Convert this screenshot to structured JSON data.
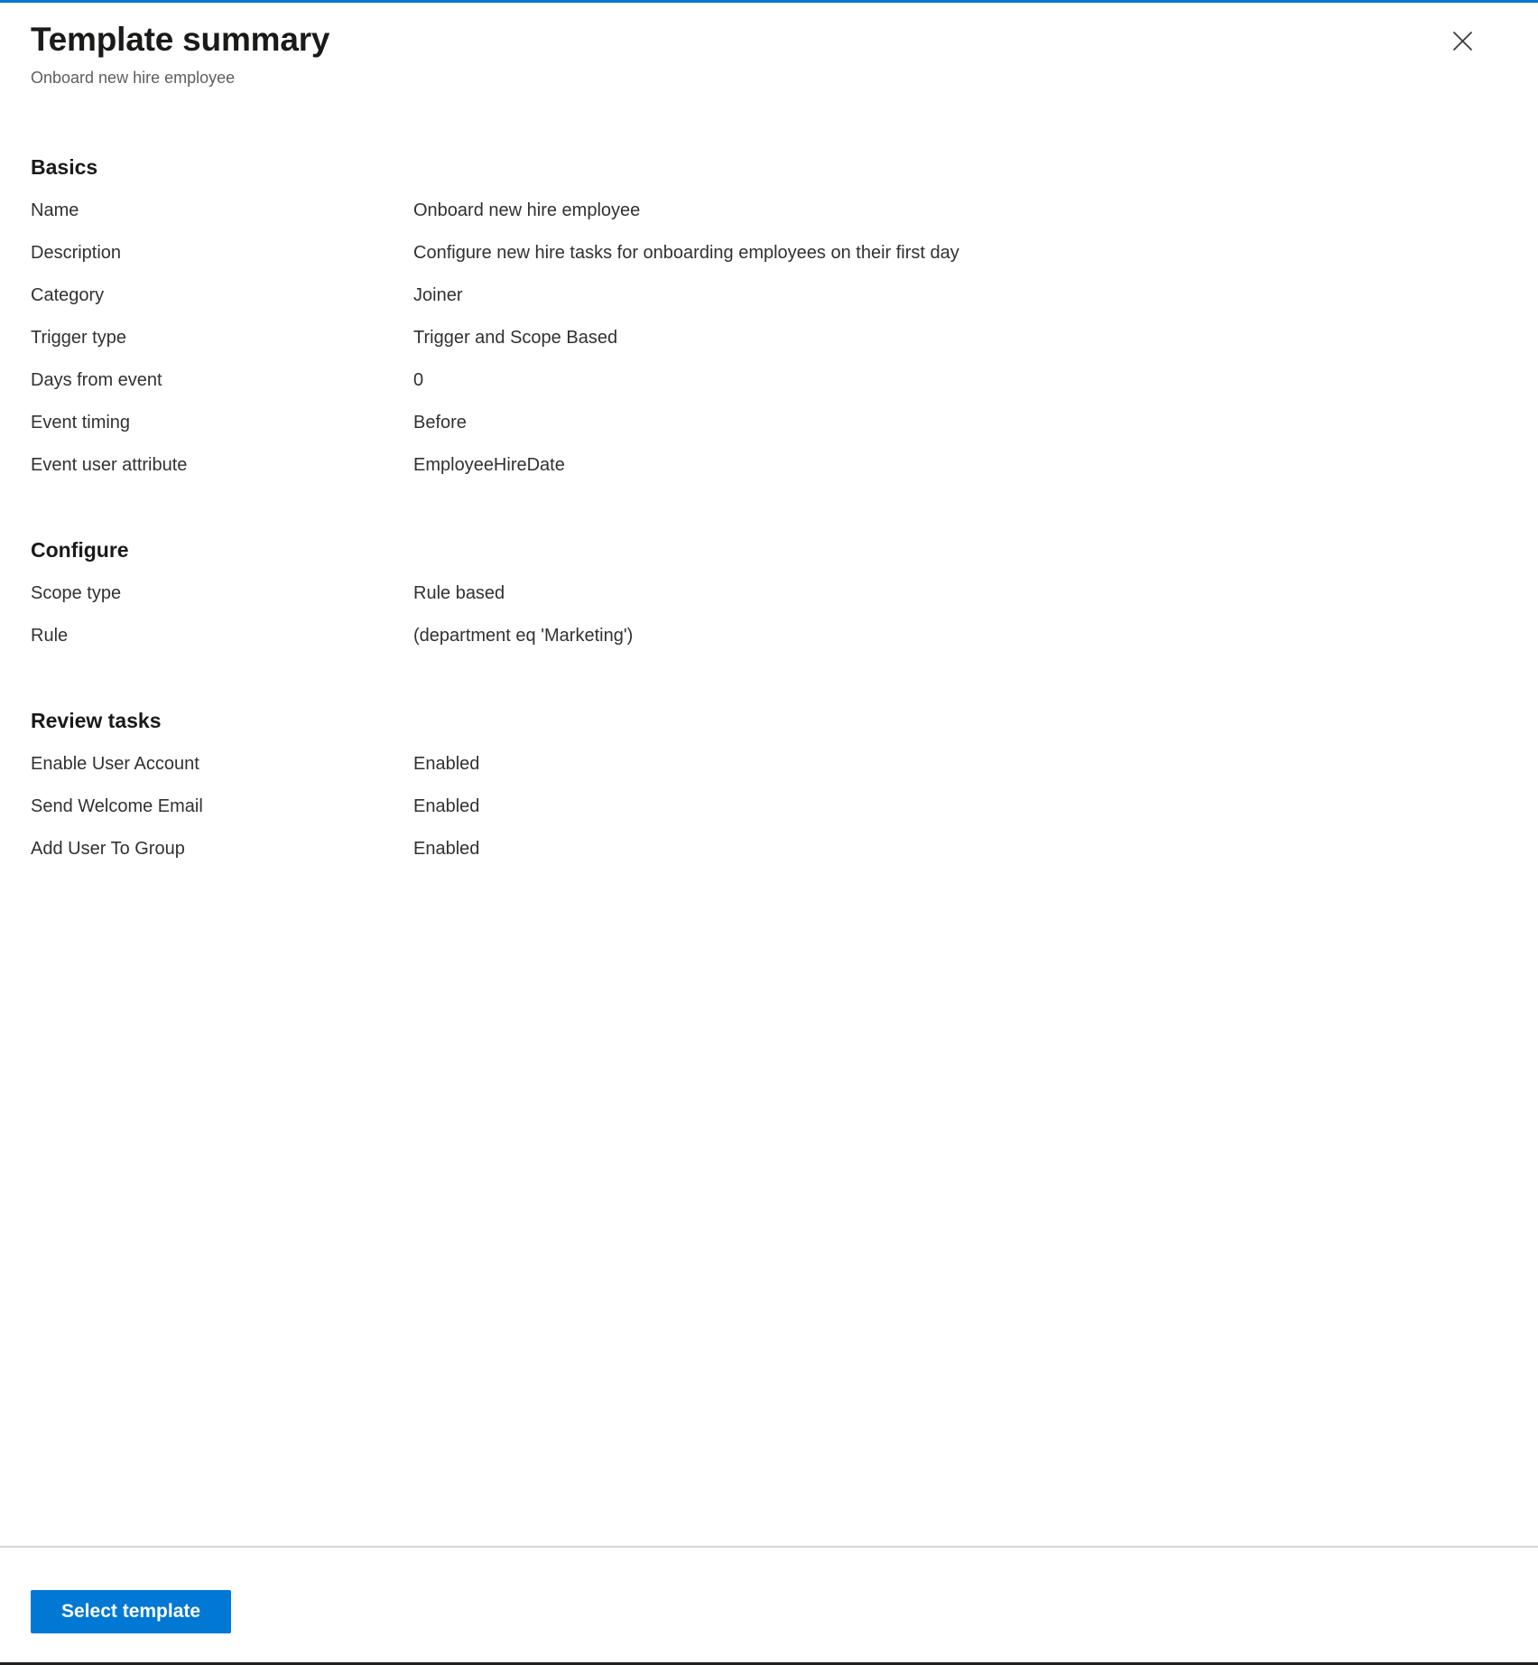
{
  "header": {
    "title": "Template summary",
    "subtitle": "Onboard new hire employee",
    "close_icon": "close-icon",
    "close_label": "Close"
  },
  "accent_color": "#0078d4",
  "sections": [
    {
      "heading": "Basics",
      "rows": [
        {
          "label": "Name",
          "value": "Onboard new hire employee"
        },
        {
          "label": "Description",
          "value": "Configure new hire tasks for onboarding employees on their first day"
        },
        {
          "label": "Category",
          "value": "Joiner"
        },
        {
          "label": "Trigger type",
          "value": "Trigger and Scope Based"
        },
        {
          "label": "Days from event",
          "value": "0"
        },
        {
          "label": "Event timing",
          "value": "Before"
        },
        {
          "label": "Event user attribute",
          "value": "EmployeeHireDate"
        }
      ]
    },
    {
      "heading": "Configure",
      "rows": [
        {
          "label": "Scope type",
          "value": "Rule based"
        },
        {
          "label": "Rule",
          "value": "(department eq 'Marketing')"
        }
      ]
    },
    {
      "heading": "Review tasks",
      "rows": [
        {
          "label": "Enable User Account",
          "value": "Enabled"
        },
        {
          "label": "Send Welcome Email",
          "value": "Enabled"
        },
        {
          "label": "Add User To Group",
          "value": "Enabled"
        }
      ]
    }
  ],
  "footer": {
    "primary_button_label": "Select template"
  }
}
